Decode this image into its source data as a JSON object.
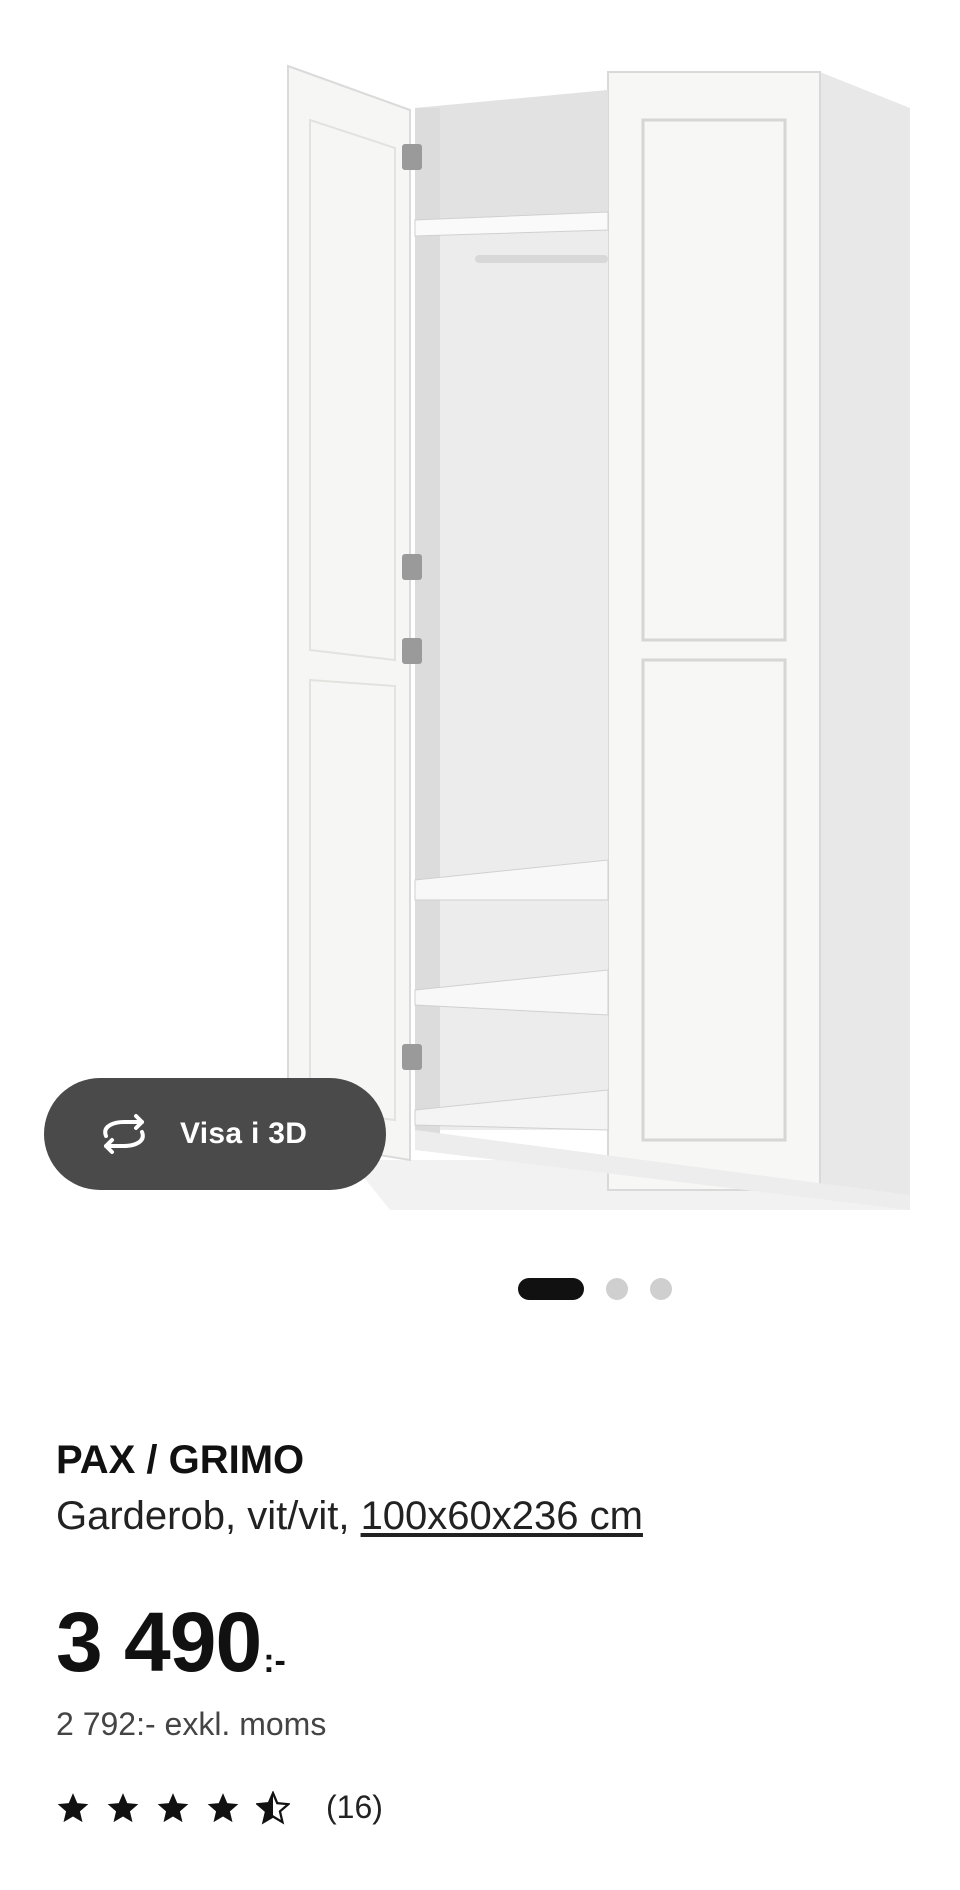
{
  "gallery": {
    "image_description_icon": "wardrobe-image",
    "view3d_label": "Visa i 3D",
    "view3d_icon": "rotate-3d-icon",
    "slide_count": 3,
    "active_slide": 1
  },
  "product": {
    "name": "PAX / GRIMO",
    "description_prefix": "Garderob, vit/vit, ",
    "measurements": "100x60x236 cm"
  },
  "price": {
    "amount": "3 490",
    "suffix": ":-",
    "excl_vat": "2 792:- exkl. moms"
  },
  "rating": {
    "stars": 4.5,
    "max_stars": 5,
    "count_label": "(16)"
  },
  "colors": {
    "button_bg": "#4a4a4a",
    "dot_active": "#111111",
    "dot_inactive": "#cfcfcf",
    "text": "#111111"
  }
}
